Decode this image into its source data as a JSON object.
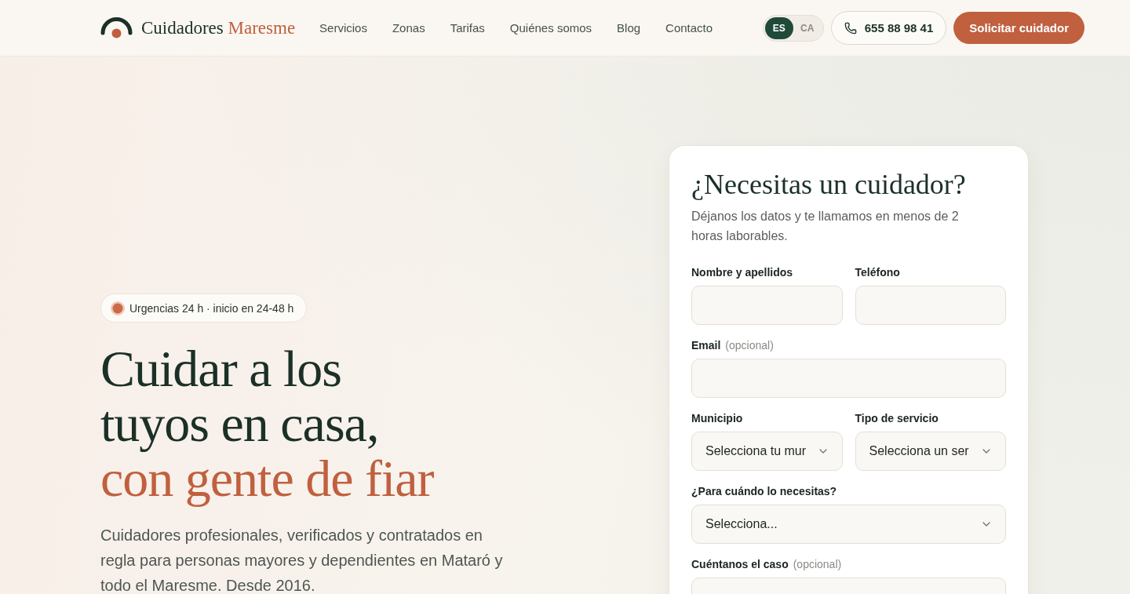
{
  "header": {
    "brand": {
      "name": "Cuidadores",
      "accent": "Maresme"
    },
    "nav": [
      "Servicios",
      "Zonas",
      "Tarifas",
      "Quiénes somos",
      "Blog",
      "Contacto"
    ],
    "languages": [
      {
        "label": "ES",
        "selected": true
      },
      {
        "label": "CA",
        "selected": false
      }
    ],
    "phone": "655 88 98 41",
    "cta": "Solicitar cuidador"
  },
  "hero": {
    "badge": "Urgencias 24 h · inicio en 24-48 h",
    "headline": {
      "lines": [
        "Cuidar a los",
        "tuyos en casa,"
      ],
      "accent": "con gente de fiar"
    },
    "description": "Cuidadores profesionales, verificados y contratados en regla para personas mayores y dependientes en Mataró y todo el Maresme. Desde 2016."
  },
  "form": {
    "title": "¿Necesitas un cuidador?",
    "subtitle": "Déjanos los datos y te llamamos en menos de 2 horas laborables.",
    "rows": [
      [
        {
          "kind": "input",
          "label": "Nombre y apellidos"
        },
        {
          "kind": "input",
          "label": "Teléfono"
        }
      ],
      [
        {
          "kind": "input",
          "label": "Email",
          "note": "(opcional)"
        }
      ],
      [
        {
          "kind": "select",
          "label": "Municipio",
          "value": "Selecciona tu mur"
        },
        {
          "kind": "select",
          "label": "Tipo de servicio",
          "value": "Selecciona un ser"
        }
      ],
      [
        {
          "kind": "select",
          "label": "¿Para cuándo lo necesitas?",
          "value": "Selecciona..."
        }
      ],
      [
        {
          "kind": "textarea",
          "label": "Cuéntanos el caso",
          "note": "(opcional)"
        }
      ]
    ]
  }
}
